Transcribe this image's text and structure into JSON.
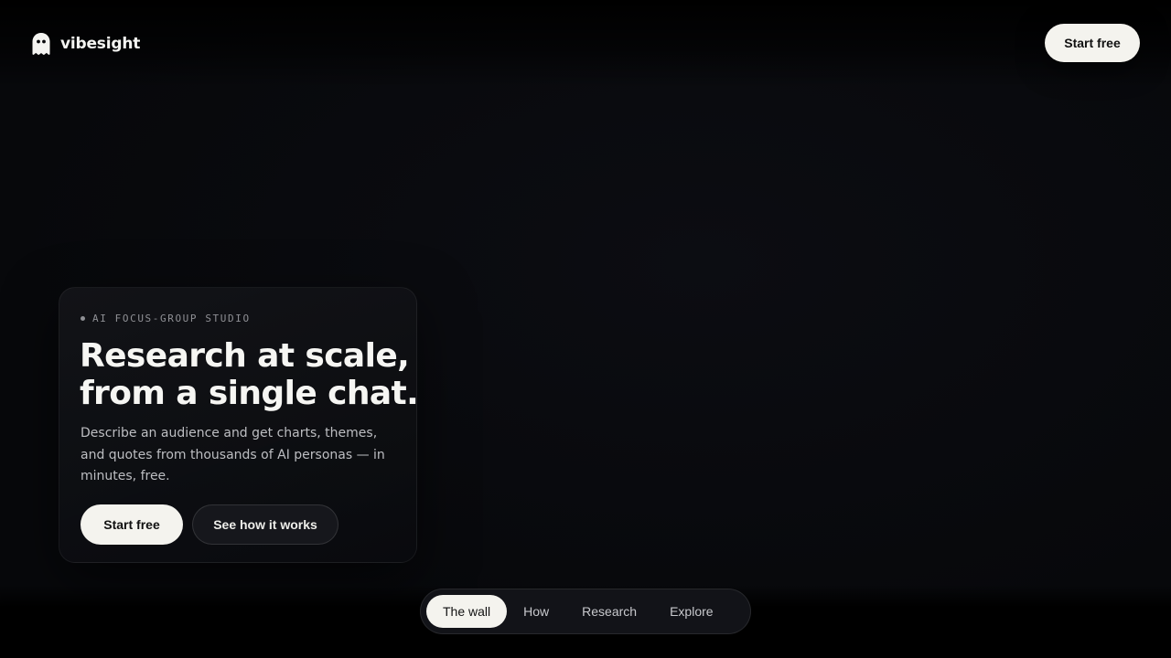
{
  "brand": {
    "name": "vibesight",
    "logo_icon": "ghost-icon"
  },
  "nav": {
    "cta_label": "Start free"
  },
  "hero": {
    "eyebrow": "AI FOCUS-GROUP STUDIO",
    "headline_line1": "Research at scale,",
    "headline_line2": "from a single chat.",
    "lede": "Describe an audience and get charts, themes, and quotes from thousands of AI personas — in minutes, free.",
    "primary_cta": "Start free",
    "secondary_cta": "See how it works"
  },
  "dock": {
    "items": [
      {
        "label": "The wall",
        "active": true
      },
      {
        "label": "How",
        "active": false
      },
      {
        "label": "Research",
        "active": false
      },
      {
        "label": "Explore",
        "active": false
      }
    ]
  },
  "colors": {
    "background": "#07080b",
    "card": "#111216",
    "accent_button": "#f4f3ee",
    "text_primary": "#f6f6f3",
    "text_muted": "#bdbec2"
  }
}
